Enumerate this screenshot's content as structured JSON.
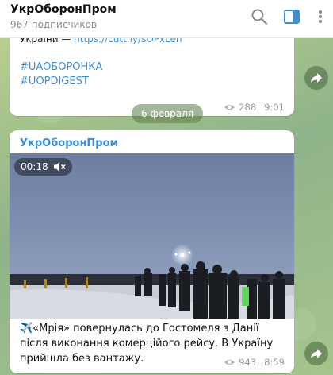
{
  "header": {
    "title": "УкрОборонПром",
    "subtitle": "967 подписчиков"
  },
  "messages": [
    {
      "text_prefix": "України — ",
      "link": "https://cutt.ly/sOPxLen",
      "tags": [
        "#UAOБОРОНКА",
        "#UOPDIGEST"
      ],
      "views": "288",
      "time": "9:01"
    },
    {
      "sender": "УкрОборонПром",
      "video_duration": "00:18",
      "text": "✈️«Мрія» повернулась до Гостомеля з Данії після виконання комерційого рейсу. В Україну прийшла без вантажу.",
      "views": "943",
      "time": "8:59"
    }
  ],
  "date_divider": "6 февраля",
  "colors": {
    "accent": "#3a8fd8",
    "bubble": "#ffffff",
    "background": "#9fbf8a"
  },
  "icons": {
    "search": "search-icon",
    "sidebar": "sidebar-toggle-icon",
    "more": "more-vertical-icon",
    "share": "share-arrow-icon",
    "views": "eye-icon",
    "mute": "mute-icon"
  }
}
